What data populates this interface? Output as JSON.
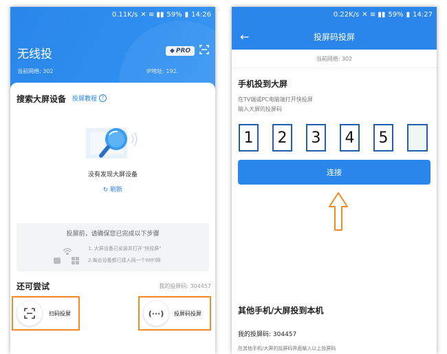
{
  "left_screen": {
    "status": {
      "speed": "0.11K/s",
      "battery": "59%",
      "time": "14:26"
    },
    "app_title": "无线投",
    "pro_badge": "PRO",
    "network_label": "当前网络: 302",
    "ip_label": "IP地址: 192.",
    "search_title": "搜索大屏设备",
    "tutorial_link": "投屏教程",
    "empty_text": "没有发现大屏设备",
    "refresh_label": "刷新",
    "steps": {
      "title": "投屏前，请确保您已完成以下步骤",
      "step1": "1. 大屏设备已安装并打开\"快投屏\"",
      "step2": "2.每台设备都已接入同一个WIFI网"
    },
    "try_title": "还可尝试",
    "my_code": "我的投屏码: 304457",
    "option_scan": "扫码投屏",
    "option_code": "投屏码投屏",
    "option_code_icon_text": "(···)"
  },
  "right_screen": {
    "status": {
      "speed": "0.22K/s",
      "battery": "59%",
      "time": "14:27"
    },
    "title": "投屏码投屏",
    "network_label": "当前网络: 302",
    "section1_title": "手机投到大屏",
    "hint1": "在TV端或PC电脑端打开快投屏",
    "hint2": "输入大屏的投屏码",
    "digits": [
      "1",
      "2",
      "3",
      "4",
      "5",
      ""
    ],
    "connect_label": "连接",
    "section2_title": "其他手机/大屏投到本机",
    "my_code": "我的投屏码: 304457",
    "hint3": "在其他手机/大屏的投屏码界面输入以上投屏码"
  },
  "colors": {
    "primary": "#2a86ea",
    "highlight": "#f08a24",
    "digit_border": "#1e5fb0"
  }
}
